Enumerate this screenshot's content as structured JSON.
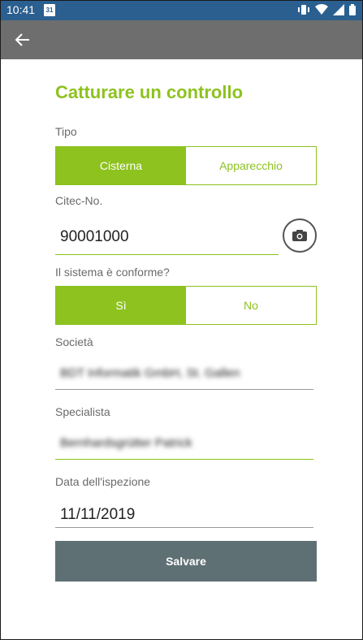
{
  "status": {
    "time": "10:41",
    "calendar_day": "31",
    "icons": [
      "vibrate-icon",
      "wifi-icon",
      "signal-icon",
      "battery-icon"
    ]
  },
  "appbar": {
    "back_icon": "arrow-left-icon"
  },
  "form": {
    "title": "Catturare un controllo",
    "tipo_label": "Tipo",
    "tipo_options": [
      "Cisterna",
      "Apparecchio"
    ],
    "tipo_selected": "Cisterna",
    "citec_label": "Citec-No.",
    "citec_value": "90001000",
    "camera_icon": "camera-icon",
    "conforme_label": "Il sistema è conforme?",
    "conforme_options": [
      "Sì",
      "No"
    ],
    "conforme_selected": "Sì",
    "societa_label": "Società",
    "societa_value": "BDT Informatik GmbH, St. Gallen",
    "specialista_label": "Specialista",
    "specialista_value": "Bernhardsgrütter Patrick",
    "data_label": "Data dell'ispezione",
    "data_value": "11/11/2019",
    "save_label": "Salvare"
  },
  "colors": {
    "accent": "#8dc21f",
    "status_bar": "#2b5f8f",
    "app_bar": "#6e6e6e",
    "save_button": "#5f7074"
  }
}
